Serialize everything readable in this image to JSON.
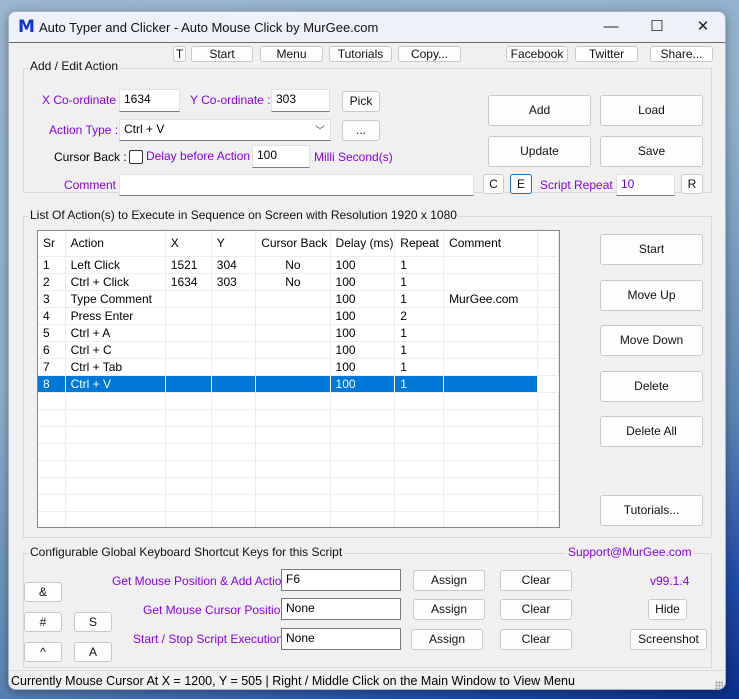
{
  "window": {
    "logo": "M",
    "title": "Auto Typer and Clicker - Auto Mouse Click by MurGee.com",
    "controls": {
      "minimize": "—",
      "maximize": "☐",
      "close": "✕"
    }
  },
  "toolbar": {
    "t_label": "T",
    "start_label": "Start",
    "menu_label": "Menu",
    "tutorials_label": "Tutorials",
    "copy_label": "Copy...",
    "facebook_label": "Facebook",
    "twitter_label": "Twitter",
    "share_label": "Share..."
  },
  "add_edit": {
    "group_label": "Add / Edit Action",
    "x_label": "X Co-ordinate :",
    "x_value": "1634",
    "y_label": "Y Co-ordinate :",
    "y_value": "303",
    "pick_label": "Pick",
    "action_type_label": "Action Type :",
    "action_type_value": "Ctrl + V",
    "dots_label": "...",
    "cursor_back_label": "Cursor Back :",
    "cursor_back_checked": false,
    "delay_label": "Delay before Action :",
    "delay_value": "100",
    "delay_unit": "Milli Second(s)",
    "comment_label": "Comment :",
    "comment_value": "",
    "c_label": "C",
    "e_label": "E",
    "script_repeat_label": "Script Repeat :",
    "script_repeat_value": "10",
    "r_label": "R",
    "add_label": "Add",
    "load_label": "Load",
    "update_label": "Update",
    "save_label": "Save"
  },
  "actions": {
    "group_label": "List Of Action(s) to Execute in Sequence on Screen with Resolution 1920 x 1080",
    "columns": [
      "Sr",
      "Action",
      "X",
      "Y",
      "Cursor Back",
      "Delay (ms)",
      "Repeat",
      "Comment"
    ],
    "rows": [
      {
        "sr": "1",
        "action": "Left Click",
        "x": "1521",
        "y": "304",
        "cursor_back": "No",
        "delay": "100",
        "repeat": "1",
        "comment": ""
      },
      {
        "sr": "2",
        "action": "Ctrl + Click",
        "x": "1634",
        "y": "303",
        "cursor_back": "No",
        "delay": "100",
        "repeat": "1",
        "comment": ""
      },
      {
        "sr": "3",
        "action": "Type Comment",
        "x": "",
        "y": "",
        "cursor_back": "",
        "delay": "100",
        "repeat": "1",
        "comment": "MurGee.com"
      },
      {
        "sr": "4",
        "action": "Press Enter",
        "x": "",
        "y": "",
        "cursor_back": "",
        "delay": "100",
        "repeat": "2",
        "comment": ""
      },
      {
        "sr": "5",
        "action": "Ctrl + A",
        "x": "",
        "y": "",
        "cursor_back": "",
        "delay": "100",
        "repeat": "1",
        "comment": ""
      },
      {
        "sr": "6",
        "action": "Ctrl + C",
        "x": "",
        "y": "",
        "cursor_back": "",
        "delay": "100",
        "repeat": "1",
        "comment": ""
      },
      {
        "sr": "7",
        "action": "Ctrl + Tab",
        "x": "",
        "y": "",
        "cursor_back": "",
        "delay": "100",
        "repeat": "1",
        "comment": ""
      },
      {
        "sr": "8",
        "action": "Ctrl + V",
        "x": "",
        "y": "",
        "cursor_back": "",
        "delay": "100",
        "repeat": "1",
        "comment": ""
      }
    ],
    "selected_index": 7,
    "side_buttons": {
      "start": "Start",
      "move_up": "Move Up",
      "move_down": "Move Down",
      "delete": "Delete",
      "delete_all": "Delete All",
      "tutorials": "Tutorials..."
    }
  },
  "shortcuts": {
    "group_label": "Configurable Global Keyboard Shortcut Keys for this Script",
    "support_label": "Support@MurGee.com",
    "version": "v99.1.4",
    "small_buttons": {
      "amp": "&",
      "hash": "#",
      "s": "S",
      "caret": "^",
      "a": "A"
    },
    "rows": [
      {
        "label": "Get Mouse Position & Add Action :",
        "value": "F6",
        "assign": "Assign",
        "clear": "Clear"
      },
      {
        "label": "Get Mouse Cursor Position :",
        "value": "None",
        "assign": "Assign",
        "clear": "Clear"
      },
      {
        "label": "Start / Stop Script Execution :",
        "value": "None",
        "assign": "Assign",
        "clear": "Clear"
      }
    ],
    "hide_label": "Hide",
    "screenshot_label": "Screenshot"
  },
  "status": {
    "text": "Currently Mouse Cursor At X = 1200, Y = 505 | Right / Middle Click on the Main Window to View Menu"
  },
  "colors": {
    "accent_purple": "#8a00e6",
    "selection_blue": "#0078d7",
    "logo_blue": "#1133dd"
  }
}
